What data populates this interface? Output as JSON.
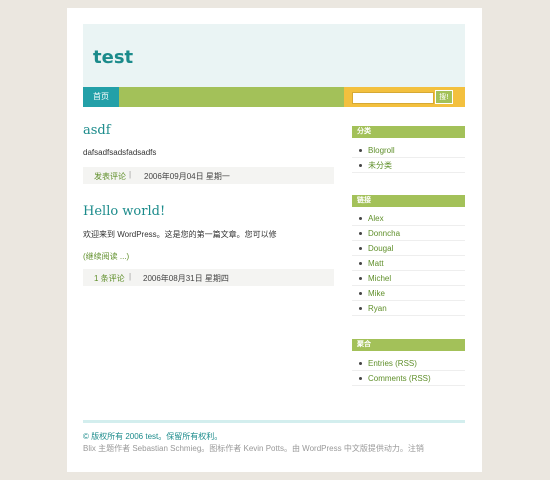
{
  "header": {
    "site_title": "test"
  },
  "nav": {
    "home_label": "首页"
  },
  "search": {
    "placeholder": "",
    "value": "",
    "button_label": "搜!"
  },
  "posts": [
    {
      "title": "asdf",
      "excerpt": "dafsadfsadsfadsadfs",
      "comments_label": "发表评论",
      "date": "2006年09月04日 星期一"
    },
    {
      "title": "Hello world!",
      "excerpt": "欢迎来到 WordPress。这是您的第一篇文章。您可以修",
      "more_label": "(继续阅读 ...)",
      "comments_label": "1 条评论",
      "date": "2006年08月31日 星期四"
    }
  ],
  "sidebar": {
    "categories": {
      "title": "分类",
      "items": [
        "Blogroll",
        "未分类"
      ]
    },
    "links": {
      "title": "链接",
      "items": [
        "Alex",
        "Donncha",
        "Dougal",
        "Matt",
        "Michel",
        "Mike",
        "Ryan"
      ]
    },
    "feeds": {
      "title": "聚合",
      "items": [
        "Entries (RSS)",
        "Comments (RSS)"
      ]
    }
  },
  "footer": {
    "copyright": "© 版权所有 2006 test。保留所有权利。",
    "credit": "Blix 主题作者 Sebastian Schmieg。图标作者 Kevin Potts。由 WordPress 中文版提供动力。注销"
  },
  "colors": {
    "accent_teal": "#1b8b8b",
    "accent_green": "#a3c159",
    "accent_yellow": "#f3c03e",
    "nav_home_bg": "#23a0a8"
  }
}
